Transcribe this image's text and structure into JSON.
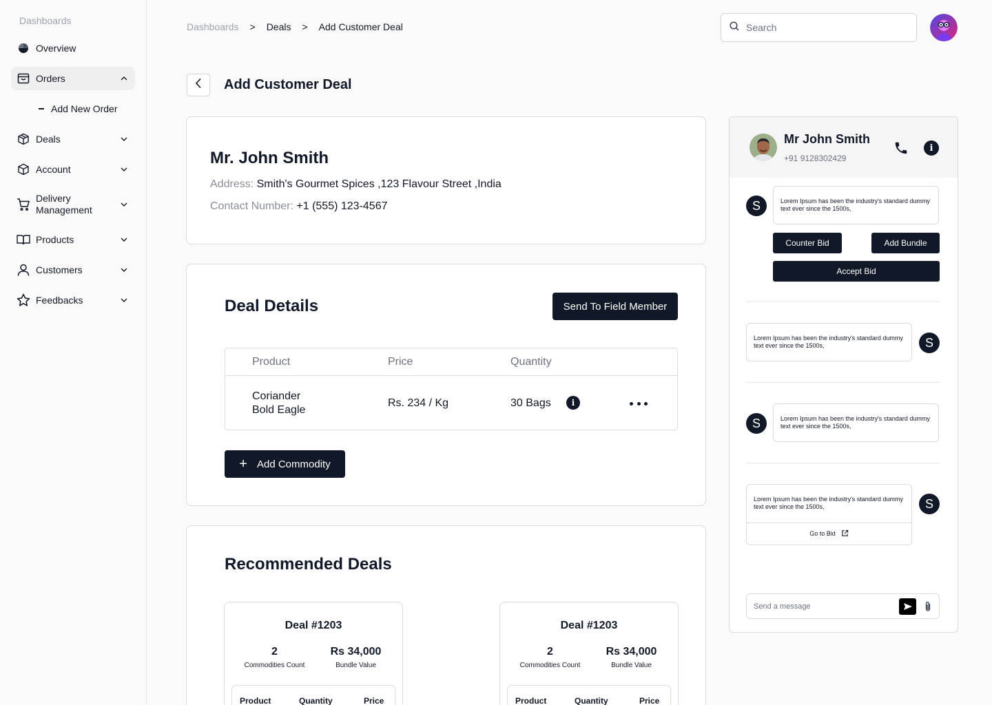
{
  "sidebar": {
    "section_title": "Dashboards",
    "items": [
      {
        "label": "Overview",
        "icon": "pie-chart-icon"
      },
      {
        "label": "Orders",
        "icon": "inbox-icon",
        "expanded": true
      },
      {
        "label": "Deals",
        "icon": "cube-icon"
      },
      {
        "label": "Account",
        "icon": "cube-icon"
      },
      {
        "label": "Delivery Management",
        "line1": "Delivery",
        "line2": "Management",
        "icon": "cart-icon"
      },
      {
        "label": "Products",
        "icon": "book-icon"
      },
      {
        "label": "Customers",
        "icon": "user-icon"
      },
      {
        "label": "Feedbacks",
        "icon": "star-icon"
      }
    ],
    "sub_item": "Add New Order"
  },
  "breadcrumb": [
    "Dashboards",
    "Deals",
    "Add Customer Deal"
  ],
  "breadcrumb_sep": ">",
  "search": {
    "placeholder": "Search"
  },
  "page_title": "Add Customer Deal",
  "customer": {
    "name": "Mr. John Smith",
    "address_label": "Address:",
    "address": "Smith's Gourmet Spices ,123 Flavour Street ,India",
    "contact_label": "Contact Number:",
    "contact": "+1 (555) 123-4567"
  },
  "deal_details": {
    "title": "Deal Details",
    "send_button": "Send To Field Member",
    "columns": [
      "Product",
      "Price",
      "Quantity"
    ],
    "row": {
      "product_line1": "Coriander",
      "product_line2": "Bold Eagle",
      "price": "Rs. 234 / Kg",
      "quantity": "30 Bags"
    },
    "add_button": "Add Commodity"
  },
  "recommended": {
    "title": "Recommended Deals",
    "cards": [
      {
        "title": "Deal #1203",
        "count": "2",
        "count_label": "Commodities Count",
        "value": "Rs 34,000",
        "value_label": "Bundle Value",
        "cols": [
          "Product",
          "Quantity",
          "Price"
        ]
      },
      {
        "title": "Deal #1203",
        "count": "2",
        "count_label": "Commodities Count",
        "value": "Rs 34,000",
        "value_label": "Bundle Value",
        "cols": [
          "Product",
          "Quantity",
          "Price"
        ]
      }
    ]
  },
  "chat": {
    "name": "Mr John Smith",
    "phone": "+91 9128302429",
    "avatar_letter": "S",
    "message": "Lorem Ipsum has been the industry's standard dummy text ever since the 1500s,",
    "counter_bid": "Counter Bid",
    "add_bundle": "Add Bundle",
    "accept_bid": "Accept Bid",
    "go_to_bid": "Go to Bid",
    "input_placeholder": "Send a message"
  },
  "colors": {
    "primary": "#111827",
    "background": "#fafafa",
    "border": "#d9dbe0"
  }
}
